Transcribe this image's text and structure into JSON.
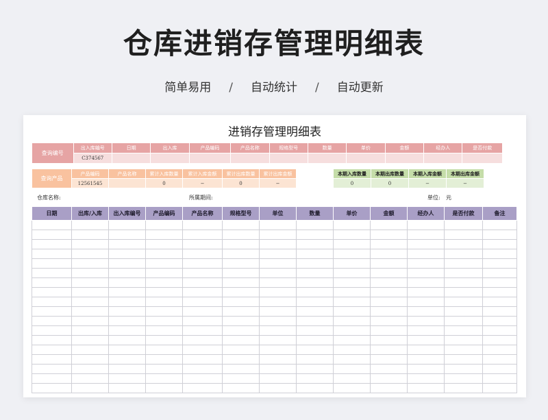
{
  "hero": {
    "title": "仓库进销存管理明细表",
    "tags": [
      "简单易用",
      "自动统计",
      "自动更新"
    ],
    "separator": "/"
  },
  "sheet": {
    "title": "进销存管理明细表",
    "query_number": {
      "label": "查询编号",
      "headers": [
        "出入库编号",
        "日期",
        "出入库",
        "产品编码",
        "产品名称",
        "规格型号",
        "数量",
        "单价",
        "金额",
        "经办人",
        "是否付款"
      ],
      "values": [
        "C374567",
        "",
        "",
        "",
        "",
        "",
        "",
        "",
        "",
        "",
        ""
      ]
    },
    "query_product": {
      "label": "查询产品",
      "headers": [
        "产品编码",
        "产品名称",
        "累计入库数量",
        "累计入库金额",
        "累计出库数量",
        "累计出库金额"
      ],
      "values": [
        "12561545",
        "",
        "0",
        "−",
        "0",
        "−"
      ]
    },
    "period_summary": {
      "headers": [
        "本期入库数量",
        "本期出库数量",
        "本期入库金额",
        "本期出库金额"
      ],
      "values": [
        "0",
        "0",
        "−",
        "−"
      ]
    },
    "info": {
      "warehouse_label": "仓库名称:",
      "period_label": "所属期间:",
      "unit_label": "单位:",
      "unit_value": "元"
    },
    "main_table": {
      "headers": [
        "日期",
        "出库/入库",
        "出入库编号",
        "产品编码",
        "产品名称",
        "规格型号",
        "单位",
        "数量",
        "单价",
        "金额",
        "经办人",
        "是否付款",
        "备注"
      ]
    }
  },
  "colors": {
    "query_number_header": "#e6a4a4",
    "query_product_header": "#f9c29f",
    "period_summary_header": "#c5dda9",
    "main_header": "#a99fc6"
  }
}
